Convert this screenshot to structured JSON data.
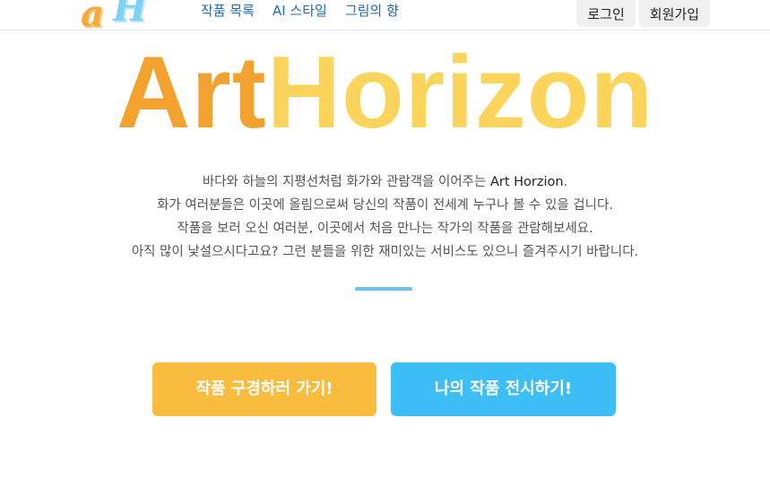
{
  "brand": {
    "logo_text_1": "a",
    "logo_text_2": "H"
  },
  "nav": {
    "links": [
      {
        "label": "작품 목록"
      },
      {
        "label": "AI 스타일"
      },
      {
        "label": "그림의 향"
      }
    ],
    "login_label": "로그인",
    "signup_label": "회원가입"
  },
  "hero": {
    "title_part_1": "Art",
    "title_part_2": "Horizon",
    "intro": {
      "line1_prefix": "바다와 하늘의 지평선처럼 화가와 관람객을 이어주는 ",
      "line1_brand": "Art Horzion",
      "line1_suffix": ".",
      "line2": "화가 여러분들은 이곳에 올림으로써 당신의 작품이 전세계 누구나 볼 수 있을 겁니다.",
      "line3": "작품을 보러 오신 여러분, 이곳에서 처음 만나는 작가의 작품을 관람해보세요.",
      "line4": "아직 많이 낯설으시다고요? 그런 분들을 위한 재미있는 서비스도 있으니 즐겨주시기 바랍니다."
    }
  },
  "cta": {
    "browse_label": "작품 구경하러 가기!",
    "exhibit_label": "나의 작품 전시하기!"
  },
  "colors": {
    "title_art": "#f3a12f",
    "title_horizon": "#fbd45b",
    "nav_link": "#1d6ea8",
    "cta_browse": "#f9bc3e",
    "cta_exhibit": "#3dbff5",
    "divider": "#6cc3e8"
  }
}
